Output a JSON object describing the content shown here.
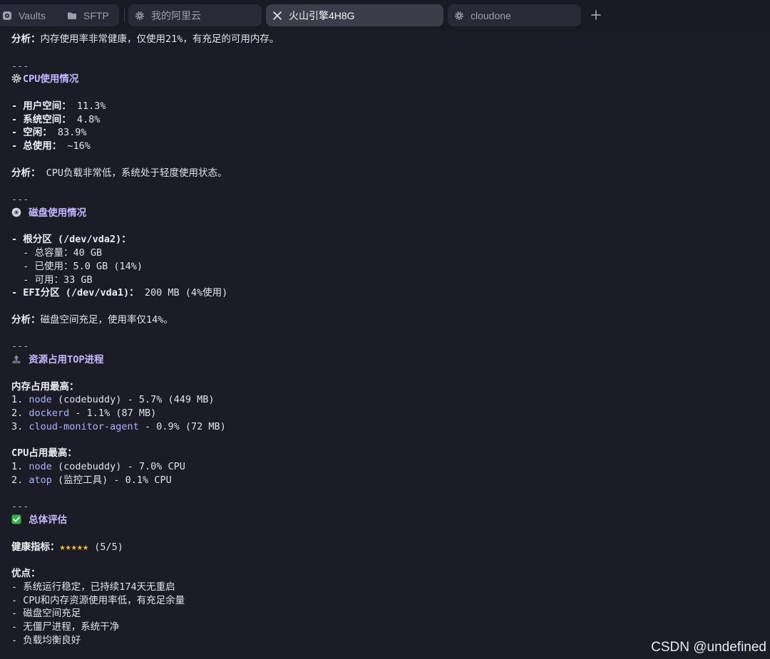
{
  "tabs": [
    {
      "label": "Vaults",
      "icon": "vault-icon",
      "active": false
    },
    {
      "label": "SFTP",
      "icon": "folder-icon",
      "active": false
    },
    {
      "label": "我的阿里云",
      "icon": "gear-icon",
      "active": false
    },
    {
      "label": "火山引擎4H8G",
      "icon": "close-icon",
      "active": true
    },
    {
      "label": "cloudone",
      "icon": "gear-icon",
      "active": false
    }
  ],
  "add_tab_icon": "plus-icon",
  "terminal": {
    "memory_analysis": {
      "label": "分析：",
      "text": "内存使用率非常健康，仅使用21%，有充足的可用内存。"
    },
    "separator": "---",
    "cpu": {
      "icon": "gear-emoji-icon",
      "title": "CPU使用情况",
      "items": [
        {
          "label": "用户空间：",
          "value": " 11.3%"
        },
        {
          "label": "系统空间：",
          "value": " 4.8%"
        },
        {
          "label": "空闲：",
          "value": " 83.9%"
        },
        {
          "label": "总使用：",
          "value": " ~16%"
        }
      ],
      "analysis_label": "分析：",
      "analysis_text": " CPU负载非常低，系统处于轻度使用状态。"
    },
    "disk": {
      "icon": "disc-icon",
      "title": "磁盘使用情况",
      "root_label": "根分区 (/dev/vda2)：",
      "root_items": [
        "总容量：40 GB",
        "已使用：5.0 GB (14%)",
        "可用：33 GB"
      ],
      "efi_label": "EFI分区 (/dev/vda1)：",
      "efi_value": " 200 MB (4%使用)",
      "analysis_label": "分析：",
      "analysis_text": "磁盘空间充足，使用率仅14%。"
    },
    "top": {
      "icon": "upload-icon",
      "title": "资源占用TOP进程",
      "mem_title": "内存占用最高：",
      "mem_items": [
        {
          "num": "1. ",
          "proc": "node",
          "detail": " (codebuddy) - 5.7% (449 MB)"
        },
        {
          "num": "2. ",
          "proc": "dockerd",
          "detail": " - 1.1% (87 MB)"
        },
        {
          "num": "3. ",
          "proc": "cloud-monitor-agent",
          "detail": " - 0.9% (72 MB)"
        }
      ],
      "cpu_title": "CPU占用最高：",
      "cpu_items": [
        {
          "num": "1. ",
          "proc": "node",
          "detail": " (codebuddy) - 7.0% CPU"
        },
        {
          "num": "2. ",
          "proc": "atop",
          "detail": " (监控工具) - 0.1% CPU"
        }
      ]
    },
    "overall": {
      "icon": "check-icon",
      "title": "总体评估",
      "health_label": "健康指标：",
      "stars": "★★★★★",
      "rating": 5,
      "rating_text": " (5/5)",
      "pros_title": "优点：",
      "pros": [
        "系统运行稳定，已持续174天无重启",
        "CPU和内存资源使用率低，有充足余量",
        "磁盘空间充足",
        "无僵尸进程，系统干净",
        "负载均衡良好"
      ]
    }
  },
  "watermark": "CSDN @undefined",
  "colors": {
    "background": "#1c1c27",
    "heading": "#c6b8ff",
    "process": "#aab4ff",
    "star": "#f4c327",
    "check": "#2fb344"
  }
}
